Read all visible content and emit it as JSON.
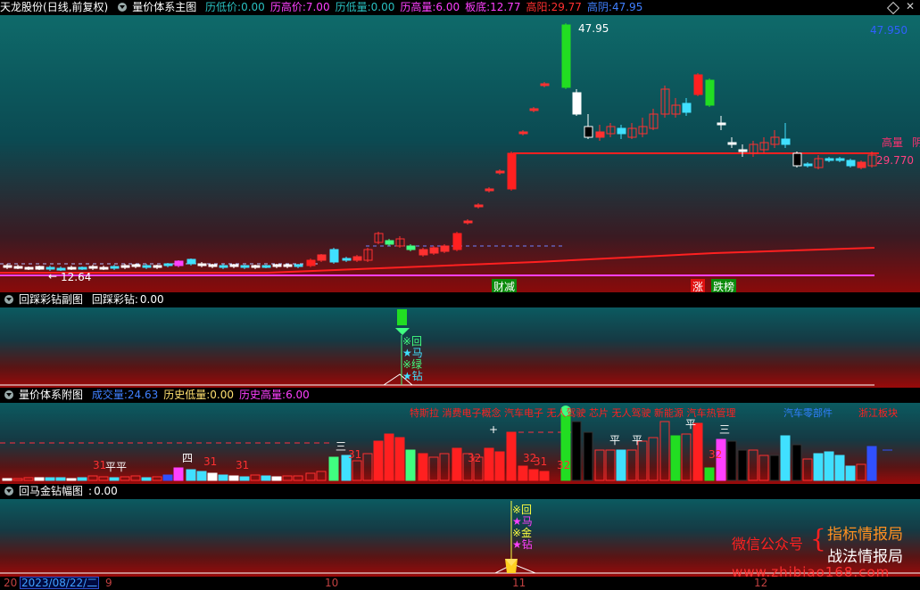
{
  "main_header": {
    "title": "天龙股份",
    "period": "(日线,前复权)",
    "indicator": "量价体系主图",
    "items": [
      {
        "label": "历低价:",
        "value": "0.00",
        "color": "#28c0c0"
      },
      {
        "label": "历高价:",
        "value": "7.00",
        "color": "#ff40ff"
      },
      {
        "label": "历低量:",
        "value": "0.00",
        "color": "#28c0c0"
      },
      {
        "label": "历高量:",
        "value": "6.00",
        "color": "#ff40ff"
      },
      {
        "label": "板底:",
        "value": "12.77",
        "color": "#ff40ff"
      },
      {
        "label": "高阳:",
        "value": "29.77",
        "color": "#ff3030"
      },
      {
        "label": "高阴:",
        "value": "47.95",
        "color": "#4080ff"
      }
    ]
  },
  "main_chart": {
    "price_high_label": "47.95",
    "axis_top_label": "47.950",
    "price_low_label": "12.64",
    "right_label_gaoliang": "高量",
    "right_label_yin": "阴",
    "right_value": "29.770",
    "tags": [
      {
        "text": "财减",
        "color": "#ffffff"
      },
      {
        "text": "涨",
        "color": "#ffffff"
      },
      {
        "text": "跌榜",
        "color": "#ffffff"
      }
    ]
  },
  "sub1": {
    "indicator": "回踩彩钻副图",
    "label": "回踩彩钻:",
    "value": "0.00",
    "signals": [
      "※回",
      "★马",
      "※绿",
      "★钻"
    ]
  },
  "sub2": {
    "indicator": "量价体系附图",
    "items": [
      {
        "label": "成交量:",
        "value": "24.63",
        "color": "#4080ff"
      },
      {
        "label": "历史低量:",
        "value": "0.00",
        "color": "#ffe070"
      },
      {
        "label": "历史高量:",
        "value": "6.00",
        "color": "#ff40ff"
      }
    ],
    "news": "特斯拉  消费电子概念  汽车电子  无人驾驶  芯片  无人驾驶  新能源  汽车热管理",
    "news_right": "汽车零部件",
    "news_far": "浙江板块",
    "marks": [
      "31",
      "平",
      "平",
      "四",
      "31",
      "31",
      "三",
      "31",
      "+",
      "32",
      "32",
      "31",
      "32",
      "平",
      "平",
      "平",
      "三",
      "32"
    ]
  },
  "sub3": {
    "indicator": "回马金钻幅图",
    "label": ":",
    "value": "0.00",
    "signals": [
      "※回",
      "★马",
      "※金",
      "★钻"
    ]
  },
  "xaxis": {
    "labels": [
      "20",
      "2023/08/22/二",
      "9",
      "10",
      "11",
      "12"
    ]
  },
  "watermark": {
    "left": "微信公众号",
    "line1": "指标情报局",
    "line2": "战法情报局",
    "url": "www.zhibiao168.com"
  }
}
